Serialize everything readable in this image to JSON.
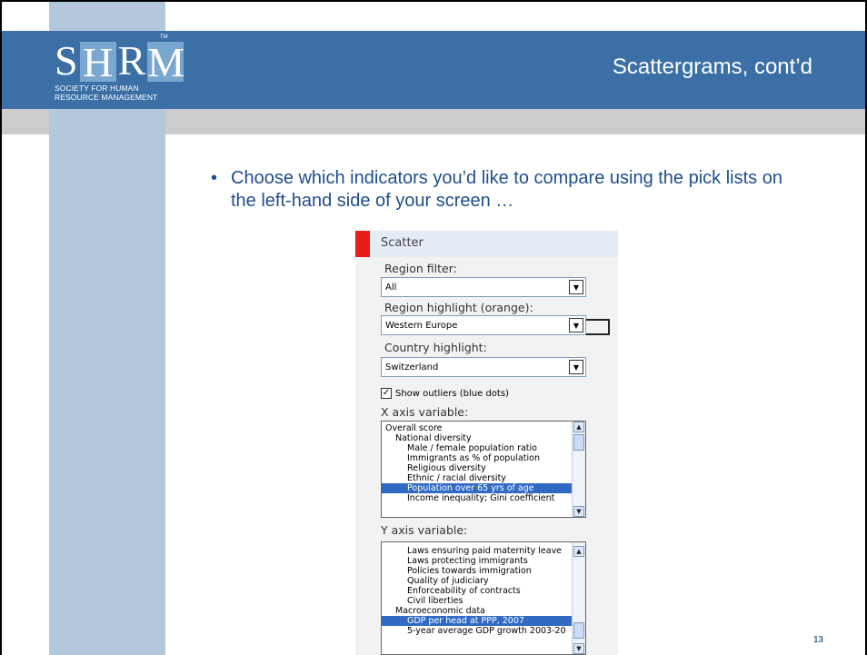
{
  "logo": {
    "letters_plain_1": "S",
    "letters_boxed_1": "H",
    "letters_plain_2": "R",
    "letters_boxed_2": "M",
    "trademark": "TM",
    "subtitle_line1": "SOCIETY FOR HUMAN",
    "subtitle_line2": "RESOURCE MANAGEMENT"
  },
  "slide": {
    "title": "Scattergrams, cont’d",
    "bullet_symbol": "•",
    "bullet_text": "Choose which indicators you’d like to compare using the pick lists on the left-hand side of your screen …",
    "page_number": "13"
  },
  "panel": {
    "title": "Scatter",
    "region_filter_label": "Region filter:",
    "region_filter_value": "All",
    "region_highlight_label": "Region highlight (orange):",
    "region_highlight_value": "Western Europe",
    "country_highlight_label": "Country highlight:",
    "country_highlight_value": "Switzerland",
    "show_outliers_label": "Show outliers (blue dots)",
    "show_outliers_checked": true,
    "x_axis_label": "X axis variable:",
    "x_axis_items": [
      {
        "text": "Overall score",
        "level": 0,
        "selected": false
      },
      {
        "text": "National diversity",
        "level": 1,
        "selected": false
      },
      {
        "text": "Male / female population ratio",
        "level": 2,
        "selected": false
      },
      {
        "text": "Immigrants as % of population",
        "level": 2,
        "selected": false
      },
      {
        "text": "Religious diversity",
        "level": 2,
        "selected": false
      },
      {
        "text": "Ethnic / racial diversity",
        "level": 2,
        "selected": false
      },
      {
        "text": "Population over 65 yrs of age",
        "level": 2,
        "selected": true
      },
      {
        "text": "Income inequality; Gini coefficient",
        "level": 2,
        "selected": false
      }
    ],
    "y_axis_label": "Y axis variable:",
    "y_axis_items": [
      {
        "text": "Laws ensuring paid maternity leave",
        "level": 2,
        "selected": false
      },
      {
        "text": "Laws protecting immigrants",
        "level": 2,
        "selected": false
      },
      {
        "text": "Policies towards immigration",
        "level": 2,
        "selected": false
      },
      {
        "text": "Quality of judiciary",
        "level": 2,
        "selected": false
      },
      {
        "text": "Enforceability of contracts",
        "level": 2,
        "selected": false
      },
      {
        "text": "Civil liberties",
        "level": 2,
        "selected": false
      },
      {
        "text": "Macroeconomic data",
        "level": 1,
        "selected": false
      },
      {
        "text": "GDP per head at PPP, 2007",
        "level": 2,
        "selected": true
      },
      {
        "text": "5-year average GDP growth 2003-20",
        "level": 2,
        "selected": false
      }
    ]
  },
  "colors": {
    "header_blue": "#3b6fa5",
    "side_column": "#b4c8dd",
    "gray_band": "#cccccc",
    "bullet_text": "#1f4e8c",
    "panel_red": "#e41b17",
    "selection_blue": "#316ac5"
  },
  "icons": {
    "dropdown": "chevron-down-icon",
    "checkbox": "check-icon",
    "scroll_up": "arrow-up-icon",
    "scroll_down": "arrow-down-icon"
  }
}
